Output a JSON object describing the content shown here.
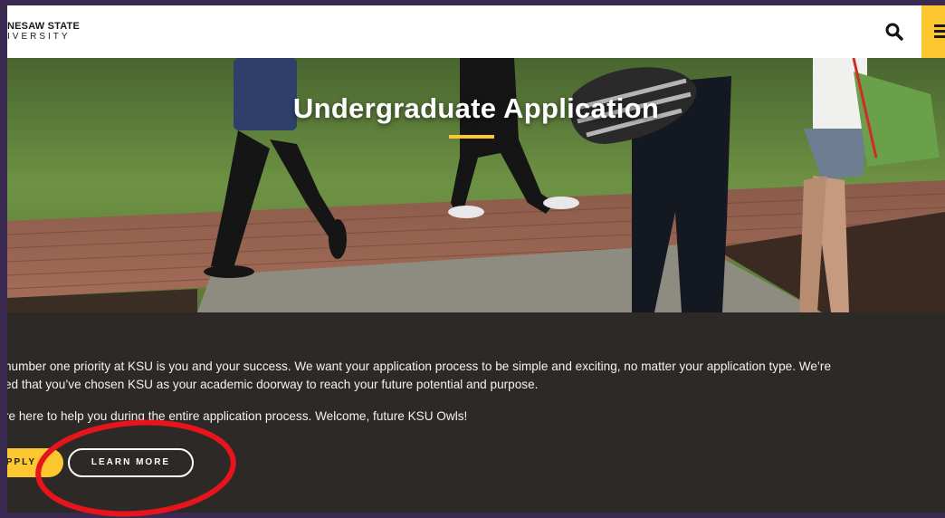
{
  "header": {
    "logo_line1": "NESAW STATE",
    "logo_line2": "IVERSITY",
    "search_icon": "search-icon",
    "menu_icon": "hamburger-menu-icon"
  },
  "hero": {
    "title": "Undergraduate Application"
  },
  "content": {
    "paragraph1_line1": "number one priority at KSU is you and your success. We want your application process to be simple and exciting, no matter your application type. We’re",
    "paragraph1_line2": "ed that you’ve chosen KSU as your academic doorway to reach your future potential and purpose.",
    "paragraph2": "re here to help you during the entire application process. Welcome, future KSU Owls!",
    "apply_label": "APPLY",
    "learn_more_label": "LEARN MORE"
  },
  "colors": {
    "brand_gold": "#fdc82f",
    "content_bg": "#2d2926",
    "annotation_red": "#e8141c"
  }
}
